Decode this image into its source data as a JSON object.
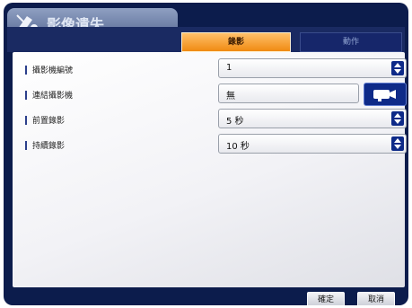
{
  "window": {
    "title": "影像遺失"
  },
  "tabs": [
    {
      "label": "錄影",
      "active": true
    },
    {
      "label": "動作",
      "active": false
    }
  ],
  "settings": [
    {
      "label": "攝影機編號",
      "value": "1",
      "control": "spinner"
    },
    {
      "label": "連結攝影機",
      "value": "無",
      "control": "camera-select"
    },
    {
      "label": "前置錄影",
      "value": "5 秒",
      "control": "spinner"
    },
    {
      "label": "持續錄影",
      "value": "10 秒",
      "control": "spinner"
    }
  ],
  "footer": {
    "ok_label": "確定",
    "cancel_label": "取消"
  },
  "colors": {
    "frame": "#0c1c4c",
    "active_tab": "#f08a12",
    "spinner": "#0e2a88",
    "content_bg": "#f2f2f6"
  },
  "icons": {
    "title": "camera-loss-icon",
    "spinner": "spinner-arrows-icon",
    "camera_button": "camera-icon"
  }
}
